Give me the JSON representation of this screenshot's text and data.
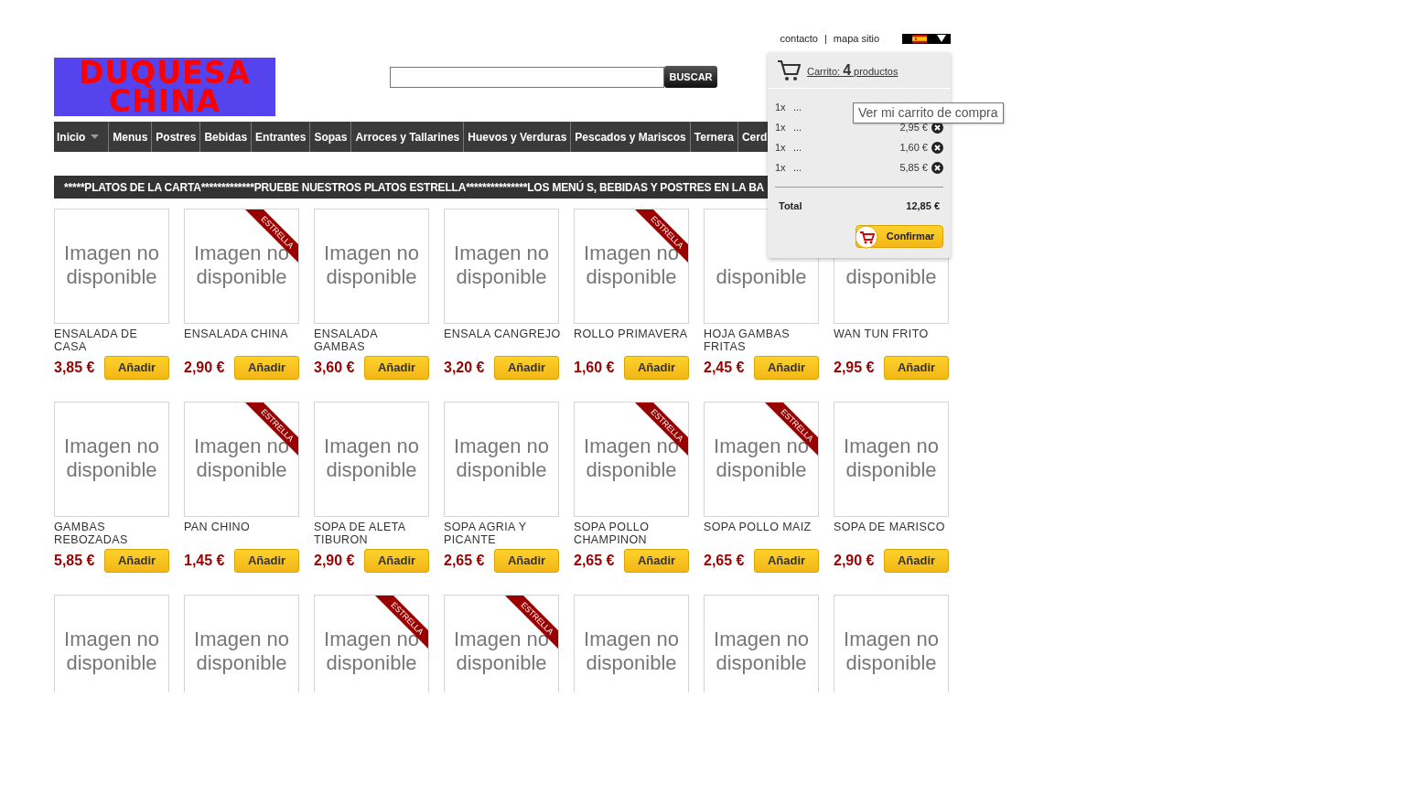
{
  "header_links": [
    {
      "label": "contacto"
    },
    {
      "label": "mapa sitio"
    }
  ],
  "header_separator": "|",
  "logo": {
    "line_1": "DUQUESA",
    "line_2": "CHINA"
  },
  "search": {
    "button": "BUSCAR"
  },
  "nav": [
    {
      "label": "Inicio",
      "has_menu": true
    },
    {
      "label": "Menus",
      "has_menu": false
    },
    {
      "label": "Postres",
      "has_menu": false
    },
    {
      "label": "Bebidas",
      "has_menu": false
    },
    {
      "label": "Entrantes",
      "has_menu": false
    },
    {
      "label": "Sopas",
      "has_menu": false
    },
    {
      "label": "Arroces y Tallarines",
      "has_menu": false
    },
    {
      "label": "Huevos y Verduras",
      "has_menu": false
    },
    {
      "label": "Pescados y Mariscos",
      "has_menu": false
    },
    {
      "label": "Ternera",
      "has_menu": false
    },
    {
      "label": "Cerd",
      "has_menu": false
    }
  ],
  "banner": "*****PLATOS DE LA CARTA*************PRUEBE NUESTROS PLATOS ESTRELLA***************LOS MENÚ S, BEBIDAS Y POSTRES EN LA BA",
  "products": [
    {
      "image_lines": [
        "Imagen no",
        "disponible"
      ],
      "name": "ENSALADA DE CASA",
      "price": "3,85 €",
      "button": "Añadir"
    },
    {
      "image_lines": [
        "Imagen no",
        "disponible"
      ],
      "ribbon": "ESTRELLA",
      "name": "ENSALADA CHINA",
      "price": "2,90 €",
      "button": "Añadir"
    },
    {
      "image_lines": [
        "Imagen no",
        "disponible"
      ],
      "name": "ENSALADA GAMBAS",
      "price": "3,60 €",
      "button": "Añadir"
    },
    {
      "image_lines": [
        "Imagen no",
        "disponible"
      ],
      "name": "ENSALA CANGREJO",
      "price": "3,20 €",
      "button": "Añadir"
    },
    {
      "image_lines": [
        "Imagen no",
        "disponible"
      ],
      "ribbon": "ESTRELLA",
      "name": "ROLLO PRIMAVERA",
      "price": "1,60 €",
      "button": "Añadir"
    },
    {
      "image_lines": [
        "disponible"
      ],
      "name": "HOJA GAMBAS FRITAS",
      "price": "2,45 €",
      "button": "Añadir"
    },
    {
      "image_lines": [
        "disponible"
      ],
      "name": "WAN TUN FRITO",
      "price": "2,95 €",
      "button": "Añadir"
    },
    {
      "image_lines": [
        "Imagen no",
        "disponible"
      ],
      "name": "GAMBAS REBOZADAS",
      "price": "5,85 €",
      "button": "Añadir"
    },
    {
      "image_lines": [
        "Imagen no",
        "disponible"
      ],
      "ribbon": "ESTRELLA",
      "name": "PAN CHINO",
      "price": "1,45 €",
      "button": "Añadir"
    },
    {
      "image_lines": [
        "Imagen no",
        "disponible"
      ],
      "name": "SOPA DE ALETA TIBURON",
      "price": "2,90 €",
      "button": "Añadir"
    },
    {
      "image_lines": [
        "Imagen no",
        "disponible"
      ],
      "name": "SOPA AGRIA Y PICANTE",
      "price": "2,65 €",
      "button": "Añadir"
    },
    {
      "image_lines": [
        "Imagen no",
        "disponible"
      ],
      "ribbon": "ESTRELLA",
      "name": "SOPA POLLO CHAMPINON",
      "price": "2,65 €",
      "button": "Añadir"
    },
    {
      "image_lines": [
        "Imagen no",
        "disponible"
      ],
      "ribbon": "ESTRELLA",
      "name": "SOPA POLLO MAIZ",
      "price": "2,65 €",
      "button": "Añadir"
    },
    {
      "image_lines": [
        "Imagen no",
        "disponible"
      ],
      "name": "SOPA DE MARISCO",
      "price": "2,90 €",
      "button": "Añadir"
    },
    {
      "image_lines": [
        "Imagen no",
        "disponible"
      ]
    },
    {
      "image_lines": [
        "Imagen no",
        "disponible"
      ]
    },
    {
      "image_lines": [
        "Imagen no",
        "disponible"
      ],
      "ribbon": "ESTRELLA"
    },
    {
      "image_lines": [
        "Imagen no",
        "disponible"
      ],
      "ribbon": "ESTRELLA"
    },
    {
      "image_lines": [
        "Imagen no",
        "disponible"
      ]
    },
    {
      "image_lines": [
        "Imagen no",
        "disponible"
      ]
    },
    {
      "image_lines": [
        "Imagen no",
        "disponible"
      ]
    }
  ],
  "cart": {
    "label": "Carrito:",
    "count": "4",
    "unit": "productos",
    "items": [
      {
        "qty": "1x",
        "name": "..."
      },
      {
        "qty": "1x",
        "name": "...",
        "price": "2,95 €"
      },
      {
        "qty": "1x",
        "name": "...",
        "price": "1,60 €"
      },
      {
        "qty": "1x",
        "name": "...",
        "price": "5,85 €"
      }
    ],
    "total_label": "Total",
    "total": "12,85 €",
    "confirm": "Confirmar"
  },
  "tooltip": "Ver mi carrito de compra"
}
